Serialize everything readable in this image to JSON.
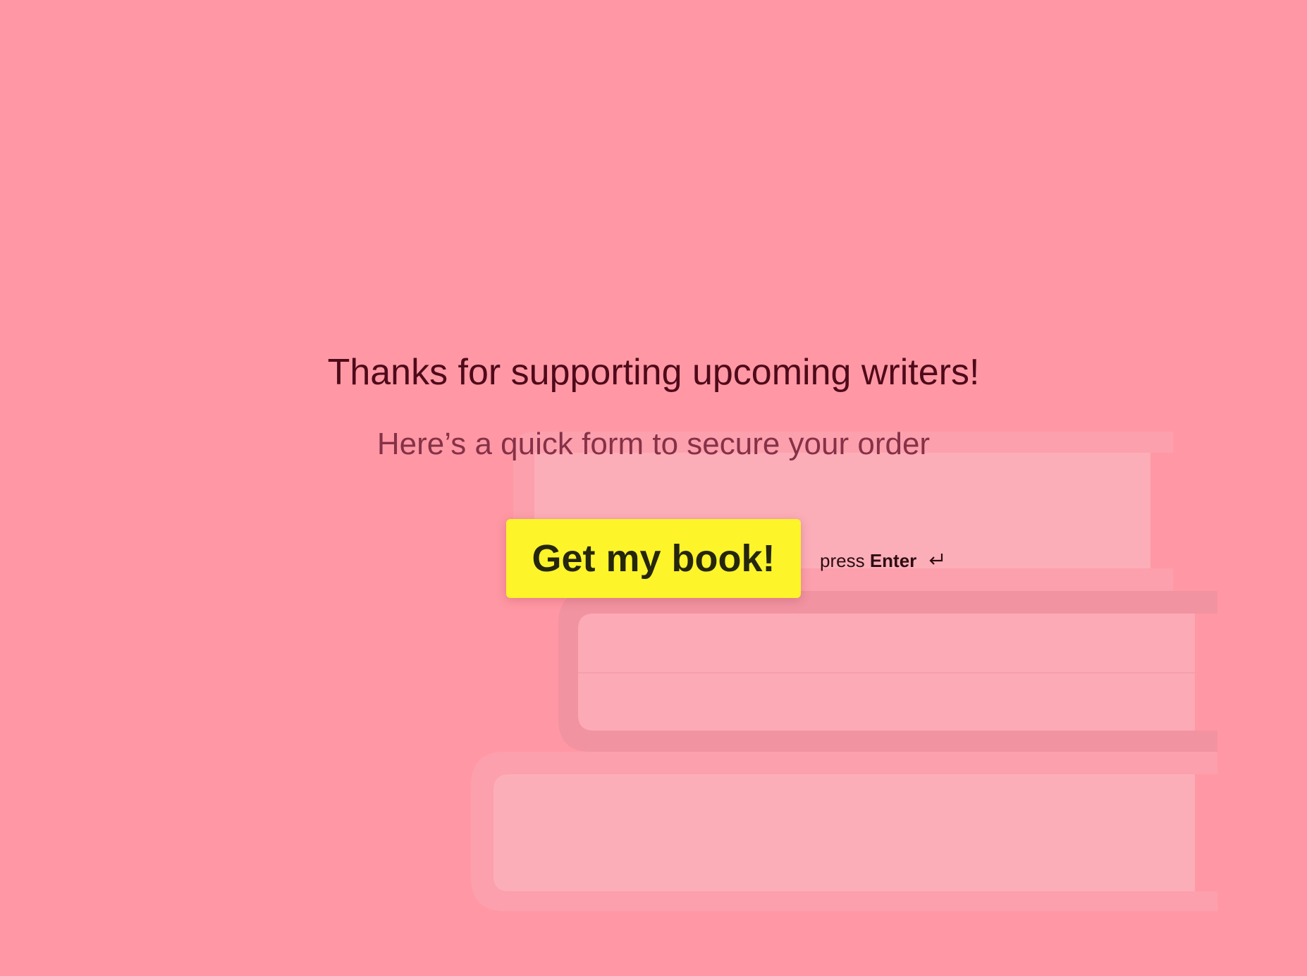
{
  "colors": {
    "background": "#ff98a4",
    "button_bg": "#fdf42a",
    "heading_text": "#4f0a1a",
    "subheading_text": "#853148"
  },
  "welcome": {
    "title": "Thanks for supporting upcoming writers!",
    "subtitle": "Here’s a quick form to secure your order",
    "button_label": "Get my book!",
    "hint_prefix": "press",
    "hint_key": "Enter",
    "hint_icon": "return-arrow-icon"
  }
}
